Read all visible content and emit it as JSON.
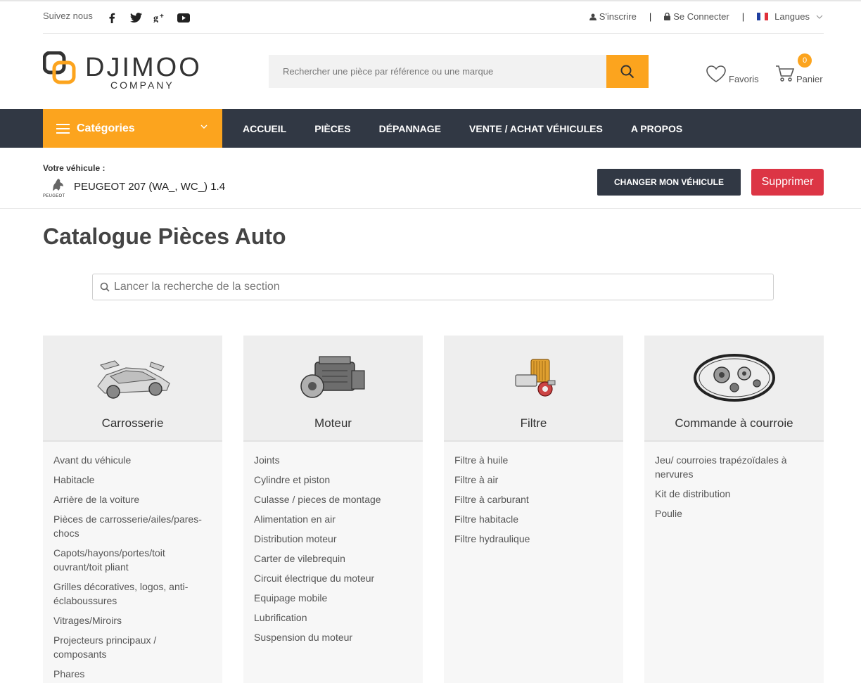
{
  "topbar": {
    "follow_label": "Suivez nous",
    "socials": [
      "facebook-icon",
      "twitter-icon",
      "google-plus-icon",
      "youtube-icon"
    ],
    "signup": "S'inscrire",
    "login": "Se Connecter",
    "languages": "Langues"
  },
  "header": {
    "logo_main": "DJIMOO",
    "logo_sub": "COMPANY",
    "search_placeholder": "Rechercher une pièce par référence ou une marque",
    "favorites": "Favoris",
    "cart": "Panier",
    "cart_count": "0",
    "accent_color": "#fca41e"
  },
  "nav": {
    "categories": "Catégories",
    "links": [
      "ACCUEIL",
      "PIÈCES",
      "DÉPANNAGE",
      "VENTE / ACHAT VÉHICULES",
      "A PROPOS"
    ],
    "bg_color": "#313844"
  },
  "vehicle": {
    "label": "Votre véhicule :",
    "brand_logo_text": "PEUGEOT",
    "name": "PEUGEOT 207 (WA_, WC_) 1.4",
    "change_button": "CHANGER MON VÉHICULE",
    "delete_button": "Supprimer"
  },
  "catalogue": {
    "title": "Catalogue Pièces Auto",
    "section_search_placeholder": "Lancer la recherche de la section",
    "cards": [
      {
        "title": "Carrosserie",
        "icon": "car-body-icon",
        "items": [
          "Avant du véhicule",
          "Habitacle",
          "Arrière de la voiture",
          "Pièces de carrosserie/ailes/pares-chocs",
          "Capots/hayons/portes/toit ouvrant/toit pliant",
          "Grilles décoratives, logos, anti-éclaboussures",
          "Vitrages/Miroirs",
          "Projecteurs principaux / composants",
          "Phares"
        ]
      },
      {
        "title": "Moteur",
        "icon": "engine-icon",
        "items": [
          "Joints",
          "Cylindre et piston",
          "Culasse / pieces de montage",
          "Alimentation en air",
          "Distribution moteur",
          "Carter de vilebrequin",
          "Circuit électrique du moteur",
          "Equipage mobile",
          "Lubrification",
          "Suspension du moteur"
        ]
      },
      {
        "title": "Filtre",
        "icon": "filter-icon",
        "items": [
          "Filtre à huile",
          "Filtre à air",
          "Filtre à carburant",
          "Filtre habitacle",
          "Filtre hydraulique"
        ]
      },
      {
        "title": "Commande à courroie",
        "icon": "belt-kit-icon",
        "items": [
          "Jeu/ courroies trapézoïdales à nervures",
          "Kit de distribution",
          "Poulie"
        ]
      }
    ]
  }
}
